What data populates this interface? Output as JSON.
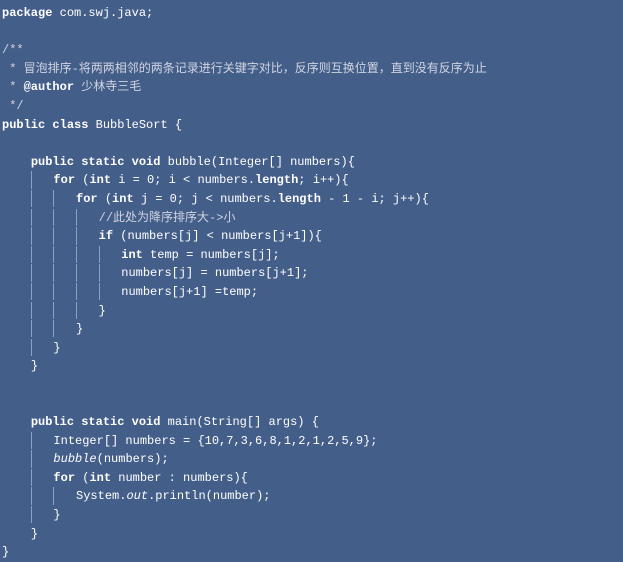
{
  "code": {
    "l1_kw1": "package",
    "l1_t": " com.swj.java;",
    "l3_c": "/**",
    "l4_c": " * 冒泡排序-将两两相邻的两条记录进行关键字对比，反序则互换位置，直到没有反序为止",
    "l5_c1": " * ",
    "l5_kw": "@author",
    "l5_c2": " 少林寺三毛",
    "l6_c": " */",
    "l7_kw1": "public",
    "l7_kw2": "class",
    "l7_t": " BubbleSort {",
    "l9_kw1": "public",
    "l9_kw2": "static",
    "l9_kw3": "void",
    "l9_t1": " bubble(Integer[] numbers){",
    "l10_kw1": "for",
    "l10_t1": " (",
    "l10_kw2": "int",
    "l10_t2": " i = 0; i < numbers.",
    "l10_kw3": "length",
    "l10_t3": "; i++){",
    "l11_kw1": "for",
    "l11_t1": " (",
    "l11_kw2": "int",
    "l11_t2": " j = 0; j < numbers.",
    "l11_kw3": "length",
    "l11_t3": " - 1 - i; j++){",
    "l12_c": "//此处为降序排序大->小",
    "l13_kw1": "if",
    "l13_t": " (numbers[j] < numbers[j+1]){",
    "l14_kw1": "int",
    "l14_t": " temp = numbers[j];",
    "l15_t": "numbers[j] = numbers[j+1];",
    "l16_t": "numbers[j+1] =temp;",
    "l17_t": "}",
    "l18_t": "}",
    "l19_t": "}",
    "l20_t": "}",
    "l23_kw1": "public",
    "l23_kw2": "static",
    "l23_kw3": "void",
    "l23_t": " main(String[] args) {",
    "l24_t": "Integer[] numbers = {10,7,3,6,8,1,2,1,2,5,9};",
    "l25_fn": "bubble",
    "l25_t": "(numbers);",
    "l26_kw1": "for",
    "l26_t1": " (",
    "l26_kw2": "int",
    "l26_t2": " number : numbers){",
    "l27_t1": "System.",
    "l27_fn": "out",
    "l27_t2": ".println(number);",
    "l28_t": "}",
    "l29_t": "}",
    "l30_t": "}"
  }
}
